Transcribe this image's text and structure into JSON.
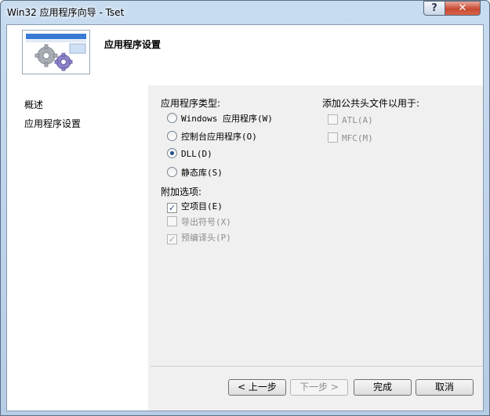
{
  "window": {
    "title": "Win32 应用程序向导 - Tset",
    "help_label": "?",
    "close_label": "✕"
  },
  "header": {
    "title": "应用程序设置",
    "image_icon": "gears-icon"
  },
  "nav": {
    "items": [
      {
        "label": "概述"
      },
      {
        "label": "应用程序设置"
      }
    ]
  },
  "app_type": {
    "heading": "应用程序类型:",
    "options": [
      {
        "label": "Windows 应用程序(W)",
        "selected": false
      },
      {
        "label": "控制台应用程序(O)",
        "selected": false
      },
      {
        "label": "DLL(D)",
        "selected": true
      },
      {
        "label": "静态库(S)",
        "selected": false
      }
    ]
  },
  "additional": {
    "heading": "附加选项:",
    "options": [
      {
        "label": "空项目(E)",
        "checked": true,
        "enabled": true
      },
      {
        "label": "导出符号(X)",
        "checked": false,
        "enabled": false
      },
      {
        "label": "预编译头(P)",
        "checked": true,
        "enabled": false
      }
    ]
  },
  "common_headers": {
    "heading": "添加公共头文件以用于:",
    "options": [
      {
        "label": "ATL(A)",
        "checked": false,
        "enabled": false
      },
      {
        "label": "MFC(M)",
        "checked": false,
        "enabled": false
      }
    ]
  },
  "buttons": {
    "prev": "< 上一步",
    "next": "下一步 >",
    "finish": "完成",
    "cancel": "取消"
  },
  "colors": {
    "selected_radio": "#1e4f8c",
    "title_gradient": "#c8dcf0",
    "close_button": "#c84a32"
  }
}
